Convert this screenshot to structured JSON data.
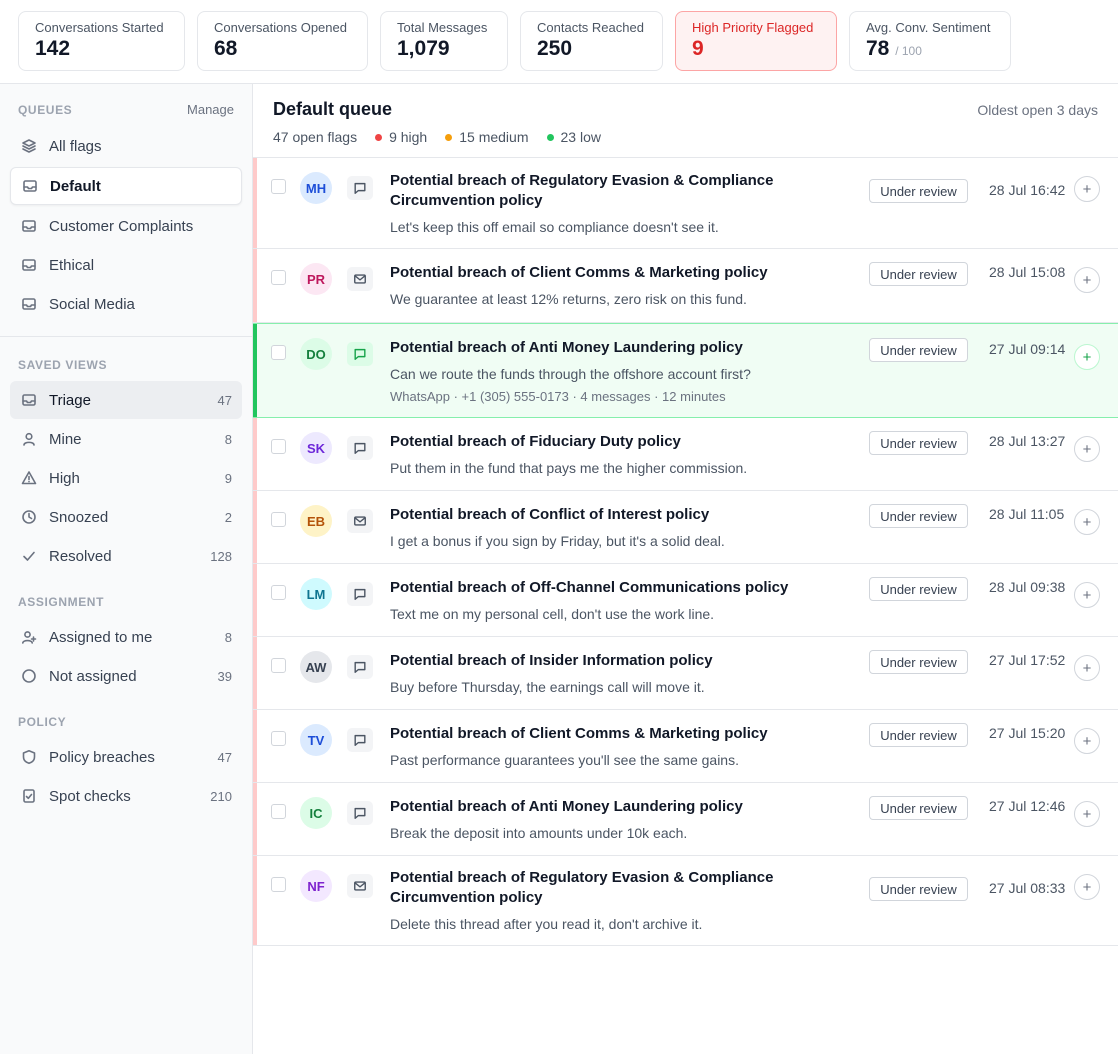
{
  "stats": [
    {
      "label": "Conversations Started",
      "value": "142"
    },
    {
      "label": "Conversations Opened",
      "value": "68"
    },
    {
      "label": "Total Messages",
      "value": "1,079"
    },
    {
      "label": "Contacts Reached",
      "value": "250"
    },
    {
      "label": "High Priority Flagged",
      "value": "9"
    },
    {
      "label": "Avg. Conv. Sentiment",
      "value": "78",
      "suffix": "/ 100"
    }
  ],
  "sidebar": {
    "queues_heading": "QUEUES",
    "manage_label": "Manage",
    "queues": [
      {
        "label": "All flags",
        "icon": "layers-icon"
      },
      {
        "label": "Default",
        "icon": "inbox-icon"
      },
      {
        "label": "Customer Complaints",
        "icon": "inbox-icon"
      },
      {
        "label": "Ethical",
        "icon": "inbox-icon"
      },
      {
        "label": "Social Media",
        "icon": "inbox-icon"
      }
    ],
    "saved_views_heading": "SAVED VIEWS",
    "saved_views": [
      {
        "label": "Triage",
        "count": "47",
        "icon": "inbox-icon"
      },
      {
        "label": "Mine",
        "count": "8",
        "icon": "user-icon"
      },
      {
        "label": "High",
        "count": "9",
        "icon": "warning-icon"
      },
      {
        "label": "Snoozed",
        "count": "2",
        "icon": "clock-icon"
      },
      {
        "label": "Resolved",
        "count": "128",
        "icon": "check-icon"
      }
    ],
    "assignment_heading": "ASSIGNMENT",
    "assignment": [
      {
        "label": "Assigned to me",
        "count": "8",
        "icon": "user-plus-icon"
      },
      {
        "label": "Not assigned",
        "count": "39",
        "icon": "circle-icon"
      }
    ],
    "policy_heading": "POLICY",
    "policy": [
      {
        "label": "Policy breaches",
        "count": "47",
        "icon": "shield-icon"
      },
      {
        "label": "Spot checks",
        "count": "210",
        "icon": "clipboard-check-icon"
      }
    ]
  },
  "queue": {
    "title": "Default queue",
    "oldest": "Oldest open 3 days",
    "open_flags": "47 open flags",
    "high": "9 high",
    "medium": "15 medium",
    "low": "23 low",
    "colors": {
      "high": "#ef4444",
      "medium": "#f59e0b",
      "low": "#22c55e"
    }
  },
  "flags": [
    {
      "initials": "MH",
      "channel": "chat-icon",
      "title": "Potential breach of Regulatory Evasion & Compliance Circumvention policy",
      "snippet": "Let's keep this off email so compliance doesn't see it.",
      "status": "Under review",
      "time": "28 Jul 16:42",
      "avatar_bg": "#dbeafe",
      "avatar_fg": "#1d4ed8"
    },
    {
      "initials": "PR",
      "channel": "mail-icon",
      "title": "Potential breach of Client Comms & Marketing policy",
      "snippet": "We guarantee at least 12% returns, zero risk on this fund.",
      "status": "Under review",
      "time": "28 Jul 15:08",
      "avatar_bg": "#fce7f3",
      "avatar_fg": "#be185d"
    },
    {
      "initials": "DO",
      "channel": "chat-icon",
      "title": "Potential breach of Anti Money Laundering policy",
      "snippet": "Can we route the funds through the offshore account first?",
      "meta": "WhatsApp · +1 (305) 555-0173 · 4 messages · 12 minutes",
      "status": "Under review",
      "time": "27 Jul 09:14",
      "avatar_bg": "#dcfce7",
      "avatar_fg": "#15803d",
      "highlighted": true
    },
    {
      "initials": "SK",
      "channel": "chat-icon",
      "title": "Potential breach of Fiduciary Duty policy",
      "snippet": "Put them in the fund that pays me the higher commission.",
      "status": "Under review",
      "time": "28 Jul 13:27",
      "avatar_bg": "#ede9fe",
      "avatar_fg": "#6d28d9"
    },
    {
      "initials": "EB",
      "channel": "mail-icon",
      "title": "Potential breach of Conflict of Interest policy",
      "snippet": "I get a bonus if you sign by Friday, but it's a solid deal.",
      "status": "Under review",
      "time": "28 Jul 11:05",
      "avatar_bg": "#fef3c7",
      "avatar_fg": "#b45309"
    },
    {
      "initials": "LM",
      "channel": "chat-icon",
      "title": "Potential breach of Off-Channel Communications policy",
      "snippet": "Text me on my personal cell, don't use the work line.",
      "status": "Under review",
      "time": "28 Jul 09:38",
      "avatar_bg": "#cffafe",
      "avatar_fg": "#0e7490"
    },
    {
      "initials": "AW",
      "channel": "chat-icon",
      "title": "Potential breach of Insider Information policy",
      "snippet": "Buy before Thursday, the earnings call will move it.",
      "status": "Under review",
      "time": "27 Jul 17:52",
      "avatar_bg": "#e5e7eb",
      "avatar_fg": "#374151"
    },
    {
      "initials": "TV",
      "channel": "chat-icon",
      "title": "Potential breach of Client Comms & Marketing policy",
      "snippet": "Past performance guarantees you'll see the same gains.",
      "status": "Under review",
      "time": "27 Jul 15:20",
      "avatar_bg": "#dbeafe",
      "avatar_fg": "#1d4ed8"
    },
    {
      "initials": "IC",
      "channel": "chat-icon",
      "title": "Potential breach of Anti Money Laundering policy",
      "snippet": "Break the deposit into amounts under 10k each.",
      "status": "Under review",
      "time": "27 Jul 12:46",
      "avatar_bg": "#dcfce7",
      "avatar_fg": "#15803d"
    },
    {
      "initials": "NF",
      "channel": "mail-icon",
      "title": "Potential breach of Regulatory Evasion & Compliance Circumvention policy",
      "snippet": "Delete this thread after you read it, don't archive it.",
      "status": "Under review",
      "time": "27 Jul 08:33",
      "avatar_bg": "#f3e8ff",
      "avatar_fg": "#7e22ce"
    }
  ],
  "plus_glyph": "+"
}
